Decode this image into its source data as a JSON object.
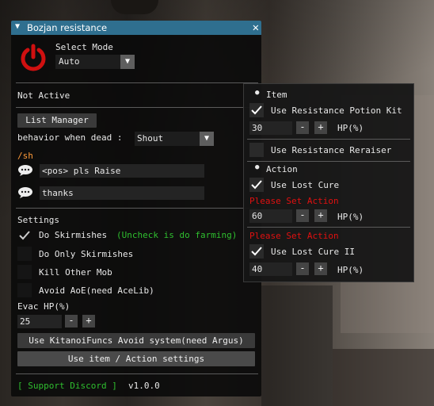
{
  "window": {
    "title": "Bozjan resistance"
  },
  "mode": {
    "label": "Select Mode",
    "value": "Auto"
  },
  "status": "Not Active",
  "list_manager_label": "List Manager",
  "dead": {
    "label": "behavior when dead :",
    "value": "Shout"
  },
  "command": "/sh",
  "messages": [
    {
      "text": "<pos> pls Raise"
    },
    {
      "text": "thanks"
    }
  ],
  "settings": {
    "header": "Settings",
    "items": [
      {
        "label": "Do Skirmishes",
        "note": "(Uncheck is do farming)",
        "checked": true
      },
      {
        "label": "Do Only Skirmishes",
        "checked": false
      },
      {
        "label": "Kill Other Mob",
        "checked": false
      },
      {
        "label": "Avoid AoE(need AceLib)",
        "checked": false
      }
    ]
  },
  "evac": {
    "label": "Evac HP(%)",
    "value": "25",
    "minus": "-",
    "plus": "+"
  },
  "kitanoi_button": "Use KitanoiFuncs Avoid system(need Argus)",
  "action_settings_button": "Use item / Action settings",
  "footer": {
    "discord": "[ Support Discord ]",
    "version": "v1.0.0"
  },
  "popup": {
    "item_header": "Item",
    "kit": {
      "label": "Use Resistance Potion Kit",
      "checked": true,
      "value": "30",
      "unit": "HP(%)"
    },
    "reraiser": {
      "label": "Use Resistance Reraiser",
      "checked": false
    },
    "action_header": "Action",
    "lost_cure": {
      "label": "Use Lost Cure",
      "checked": true,
      "warning": "Please Set Action",
      "value": "60",
      "unit": "HP(%)"
    },
    "warning2": "Please Set Action",
    "lost_cure2": {
      "label": "Use Lost Cure II",
      "checked": true,
      "value": "40",
      "unit": "HP(%)"
    },
    "minus": "-",
    "plus": "+"
  }
}
